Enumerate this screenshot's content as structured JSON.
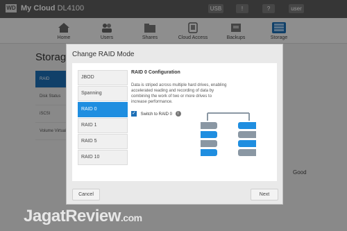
{
  "app": {
    "logo_text": "WD",
    "product_name": "My Cloud",
    "model": "DL4100",
    "top_controls": [
      "USB",
      "!",
      "?",
      "user"
    ]
  },
  "nav": {
    "items": [
      "Home",
      "Users",
      "Shares",
      "Cloud Access",
      "Backups",
      "Storage"
    ]
  },
  "storage": {
    "title": "Storage",
    "sidebar": [
      "RAID",
      "Disk Status",
      "iSCSI",
      "Volume Virtualization"
    ],
    "status_good": "Good"
  },
  "modal": {
    "title": "Change RAID Mode",
    "modes": [
      "JBOD",
      "Spanning",
      "RAID 0",
      "RAID 1",
      "RAID 5",
      "RAID 10"
    ],
    "selected_mode_index": 2,
    "config_title": "RAID 0 Configuration",
    "config_description": "Data is striped across multiple hard drives, enabling accelerated reading and recording of data by combining the work of two or more drives to increase performance.",
    "switch_label": "Switch to RAID 0",
    "switch_checked": true,
    "buttons": {
      "cancel": "Cancel",
      "next": "Next"
    }
  },
  "colors": {
    "accent": "#1f8ee0",
    "disk_gray": "#8a97a3"
  },
  "watermark": {
    "text": "JagatReview",
    "suffix": ".com"
  }
}
